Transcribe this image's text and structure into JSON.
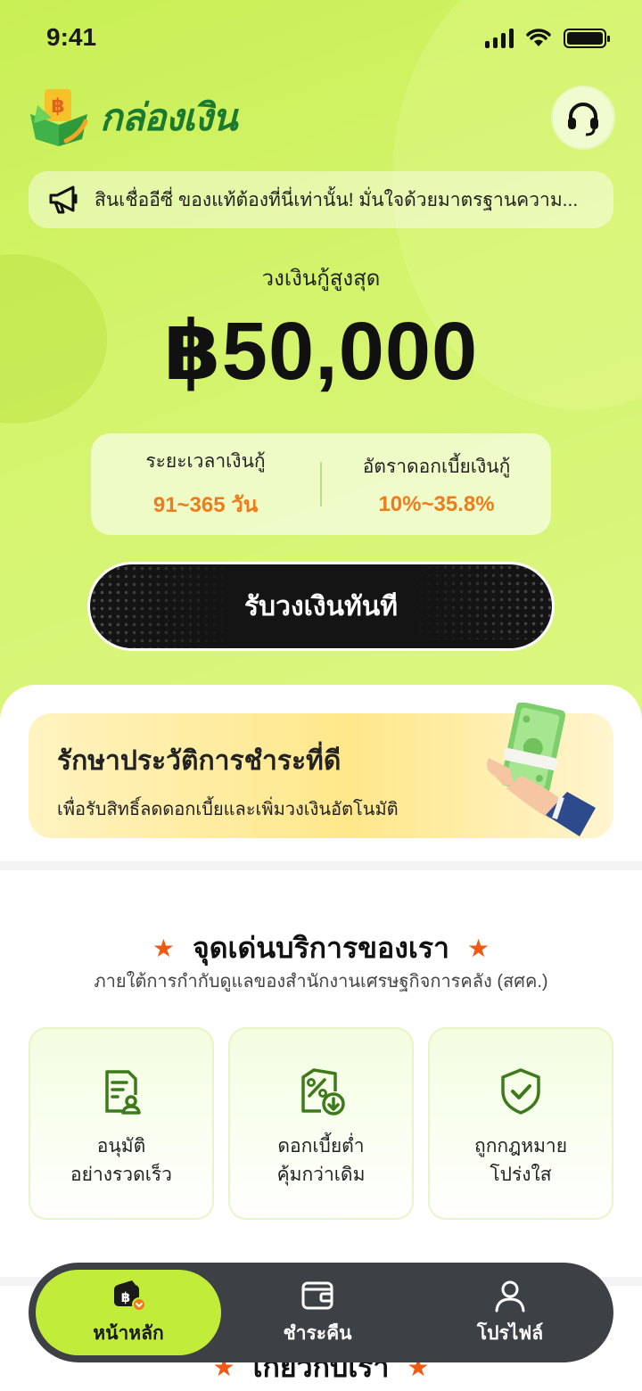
{
  "status_bar": {
    "time": "9:41"
  },
  "header": {
    "app_name": "กล่องเงิน"
  },
  "notice": {
    "text": "สินเชื่ออีซี่ ของแท้ต้องที่นี่เท่านั้น! มั่นใจด้วยมาตรฐานความ..."
  },
  "loan": {
    "limit_label": "วงเงินกู้สูงสุด",
    "limit_amount": "฿50,000",
    "term_label": "ระยะเวลาเงินกู้",
    "term_value": "91~365 วัน",
    "rate_label": "อัตราดอกเบี้ยเงินกู้",
    "rate_value": "10%~35.8%",
    "cta_label": "รับวงเงินทันที"
  },
  "promo": {
    "title": "รักษาประวัติการชำระที่ดี",
    "subtitle": "เพื่อรับสิทธิ์ลดดอกเบี้ยและเพิ่มวงเงินอัตโนมัติ"
  },
  "highlights": {
    "title": "จุดเด่นบริการของเรา",
    "subtitle": "ภายใต้การกำกับดูแลของสำนักงานเศรษฐกิจการคลัง (สศค.)",
    "items": [
      {
        "line1": "อนุมัติ",
        "line2": "อย่างรวดเร็ว",
        "icon": "document-approve-icon"
      },
      {
        "line1": "ดอกเบี้ยต่ำ",
        "line2": "คุ้มกว่าเดิม",
        "icon": "percent-down-icon"
      },
      {
        "line1": "ถูกกฎหมาย",
        "line2": "โปร่งใส",
        "icon": "shield-check-icon"
      }
    ]
  },
  "next_section": {
    "title": "เกี่ยวกับเรา"
  },
  "tabbar": {
    "items": [
      {
        "label": "หน้าหลัก",
        "icon": "wallet-baht-icon",
        "active": true
      },
      {
        "label": "ชำระคืน",
        "icon": "card-wallet-icon",
        "active": false
      },
      {
        "label": "โปรไฟล์",
        "icon": "user-icon",
        "active": false
      }
    ]
  },
  "colors": {
    "brand_green": "#1c7a2e",
    "hero_lime": "#d4f46d",
    "accent_orange": "#ef7b1a",
    "tab_active": "#c2ec3a",
    "tabbar_bg": "#3d4045"
  }
}
